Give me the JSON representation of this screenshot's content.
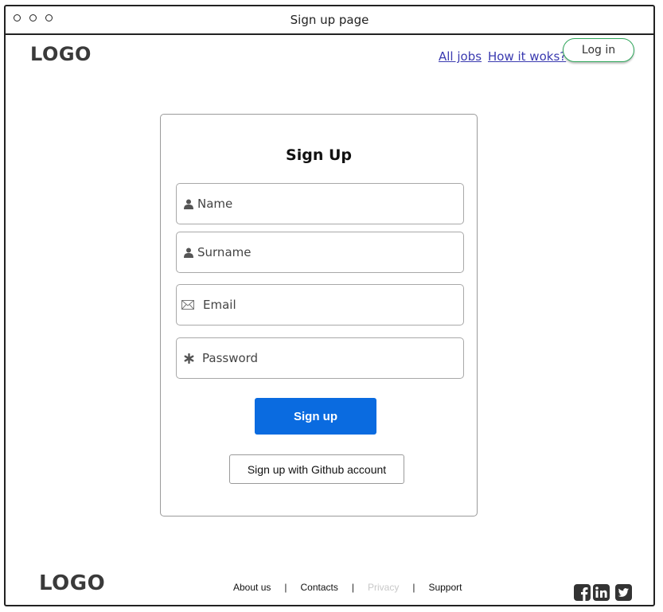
{
  "window": {
    "title": "Sign up page"
  },
  "header": {
    "logo": "LOGO",
    "nav": [
      {
        "label": "All jobs"
      },
      {
        "label": "How it woks?"
      }
    ],
    "login_label": "Log in"
  },
  "form": {
    "title": "Sign Up",
    "fields": [
      {
        "placeholder": "Name",
        "icon": "user-icon"
      },
      {
        "placeholder": "Surname",
        "icon": "user-icon"
      },
      {
        "placeholder": "Email",
        "icon": "envelope-icon"
      },
      {
        "placeholder": "Password",
        "icon": "asterisk-icon"
      }
    ],
    "submit_label": "Sign up",
    "github_label": "Sign up with Github account"
  },
  "footer": {
    "logo": "LOGO",
    "links": [
      {
        "label": "About us",
        "state": "normal"
      },
      {
        "label": "Contacts",
        "state": "normal"
      },
      {
        "label": "Privacy",
        "state": "disabled"
      },
      {
        "label": "Support",
        "state": "normal"
      }
    ],
    "social": [
      {
        "icon": "facebook-icon"
      },
      {
        "icon": "linkedin-icon"
      },
      {
        "icon": "twitter-icon"
      }
    ]
  },
  "colors": {
    "primary": "#0a6be0",
    "login_border": "#2ea65a",
    "link": "#3a3ab0"
  }
}
